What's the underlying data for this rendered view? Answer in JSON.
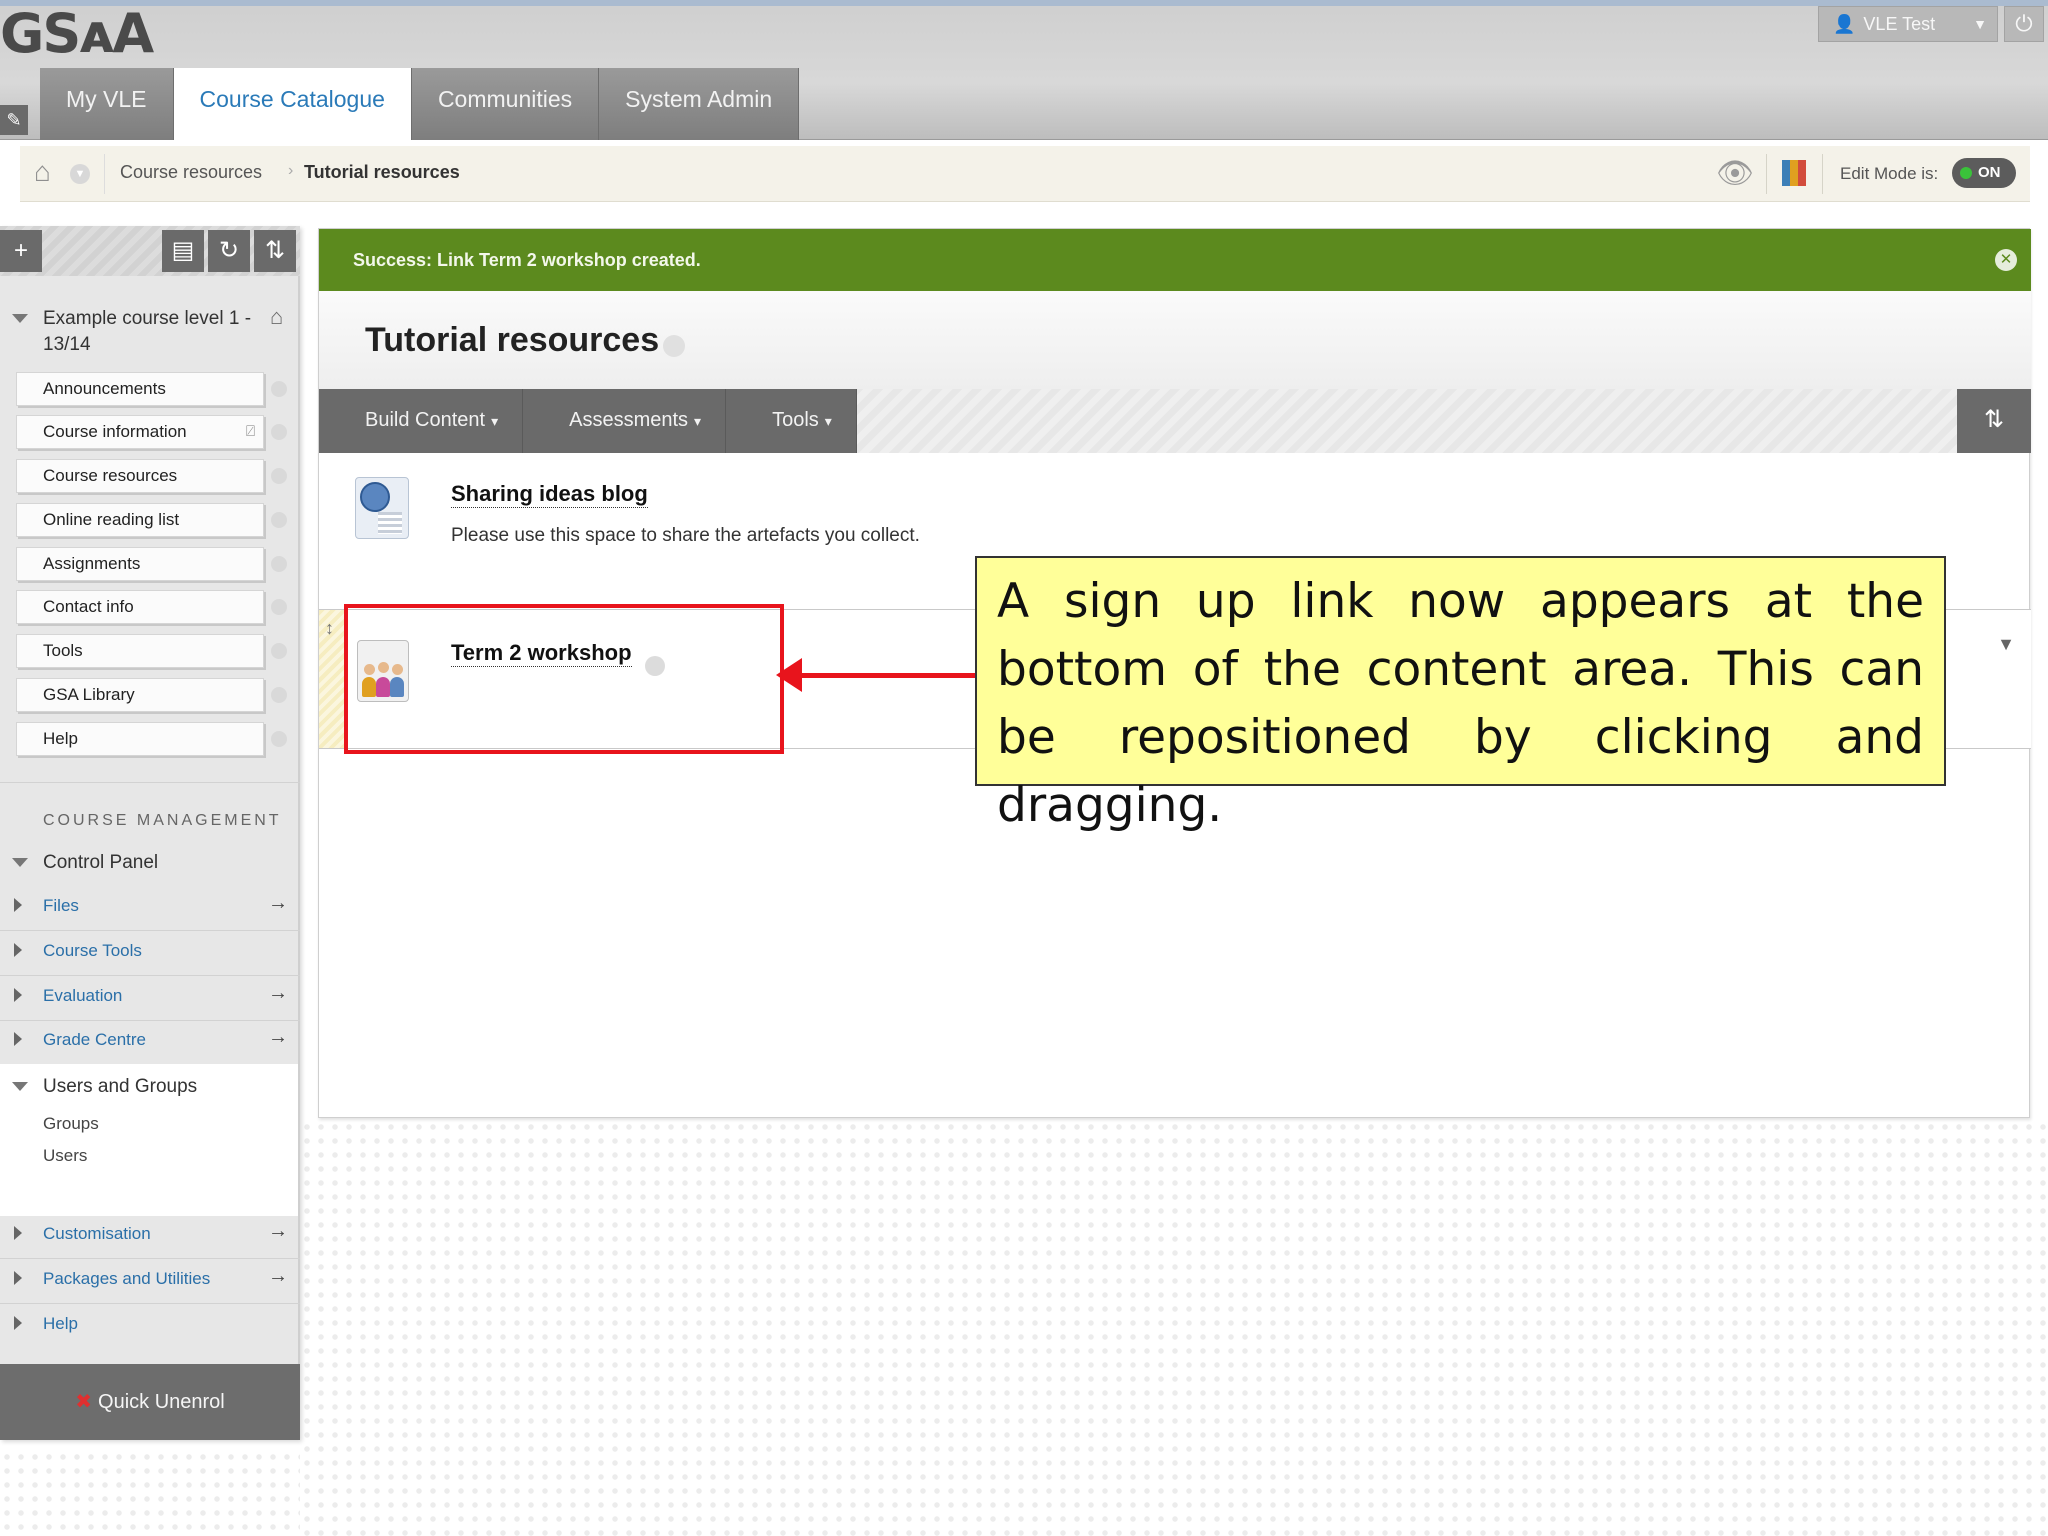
{
  "header": {
    "logo": "GSᴀA",
    "tabs": [
      {
        "label": "My VLE"
      },
      {
        "label": "Course Catalogue"
      },
      {
        "label": "Communities"
      },
      {
        "label": "System Admin"
      }
    ],
    "active_tab": "Course Catalogue",
    "user_name": "VLE Test"
  },
  "breadcrumb": {
    "items": [
      "Course resources",
      "Tutorial resources"
    ],
    "edit_mode_label": "Edit Mode is:",
    "edit_mode_value": "ON"
  },
  "sidebar": {
    "toolbar": {
      "add_icon": "+",
      "folder_icon": "folder-view-icon",
      "refresh_icon": "refresh-icon",
      "sort_icon": "sort-icon"
    },
    "course_title": "Example course level 1 - 13/14",
    "nav_items": [
      {
        "label": "Announcements"
      },
      {
        "label": "Course information",
        "hidden_icon": "⍁"
      },
      {
        "label": "Course resources"
      },
      {
        "label": "Online reading list"
      },
      {
        "label": "Assignments"
      },
      {
        "label": "Contact info"
      },
      {
        "label": "Tools"
      },
      {
        "label": "GSA Library"
      },
      {
        "label": "Help"
      }
    ],
    "course_management_label": "COURSE MANAGEMENT",
    "control_panel_label": "Control Panel",
    "control_panel_items": [
      {
        "label": "Files",
        "arrow": "→"
      },
      {
        "label": "Course Tools",
        "arrow": ""
      },
      {
        "label": "Evaluation",
        "arrow": "→"
      },
      {
        "label": "Grade Centre",
        "arrow": "→"
      }
    ],
    "users_groups_label": "Users and Groups",
    "users_groups_items": [
      "Groups",
      "Users"
    ],
    "bottom_items": [
      {
        "label": "Customisation",
        "arrow": "→"
      },
      {
        "label": "Packages and Utilities",
        "arrow": "→"
      },
      {
        "label": "Help",
        "arrow": ""
      }
    ],
    "quick_unenrol": "Quick Unenrol"
  },
  "main": {
    "success_message": "Success: Link Term 2 workshop created.",
    "page_title": "Tutorial resources",
    "action_buttons": [
      "Build Content",
      "Assessments",
      "Tools"
    ],
    "items": [
      {
        "title": "Sharing ideas blog",
        "description": "Please use this space to share the artefacts you collect."
      },
      {
        "title": "Term 2 workshop",
        "description": ""
      }
    ]
  },
  "annotation": {
    "text": "A sign up link now appears at the bottom of the content area. This can be repositioned by clicking and dragging.",
    "box_color": "#e8141c",
    "callout_color": "#ffff99"
  },
  "colors": {
    "accent_tab_text": "#2a7ab8",
    "success_bar": "#5c8a1e",
    "link_blue": "#2a6fa8",
    "toolbar_gray": "#6a6a6a"
  }
}
